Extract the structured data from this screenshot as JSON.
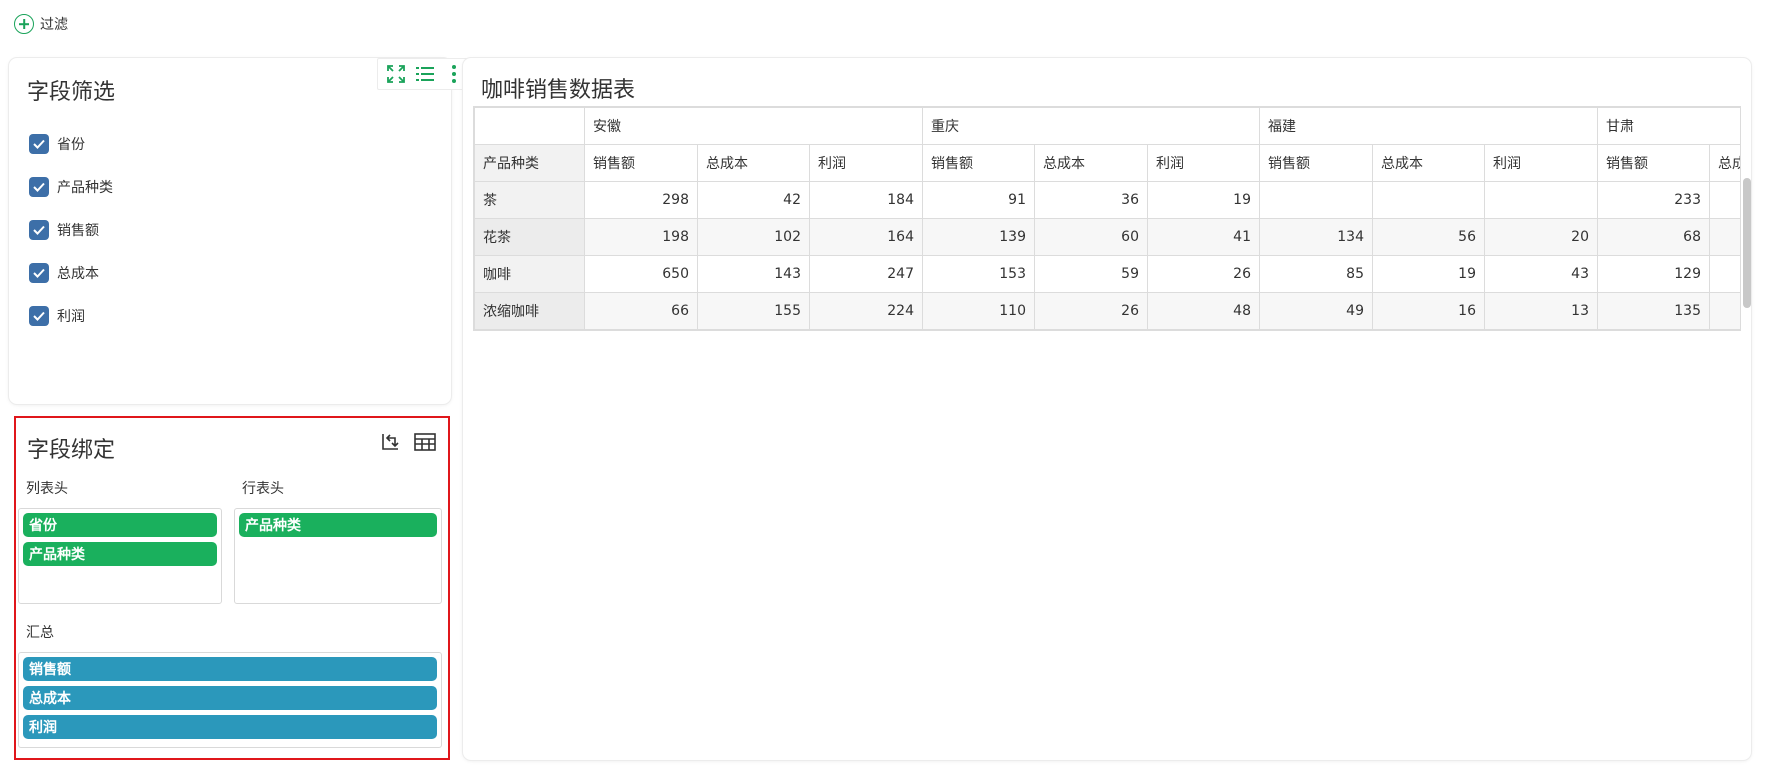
{
  "filter_bar": {
    "label": "过滤"
  },
  "field_filter": {
    "title": "字段筛选",
    "items": [
      {
        "label": "省份",
        "checked": true
      },
      {
        "label": "产品种类",
        "checked": true
      },
      {
        "label": "销售额",
        "checked": true
      },
      {
        "label": "总成本",
        "checked": true
      },
      {
        "label": "利润",
        "checked": true
      }
    ]
  },
  "field_binding": {
    "title": "字段绑定",
    "column_header_label": "列表头",
    "row_header_label": "行表头",
    "summary_label": "汇总",
    "column_fields": [
      "省份",
      "产品种类"
    ],
    "row_fields": [
      "产品种类"
    ],
    "summary_fields": [
      "销售额",
      "总成本",
      "利润"
    ]
  },
  "sales_table": {
    "title": "咖啡销售数据表",
    "row_header_title": "产品种类",
    "provinces": [
      "安徽",
      "重庆",
      "福建",
      "甘肃"
    ],
    "measures": [
      "销售额",
      "总成本",
      "利润"
    ],
    "last_province_visible_measures": [
      "销售额",
      "总成"
    ],
    "rows": [
      {
        "name": "茶",
        "values": [
          "298",
          "42",
          "184",
          "91",
          "36",
          "19",
          "",
          "",
          "",
          "233",
          ""
        ]
      },
      {
        "name": "花茶",
        "values": [
          "198",
          "102",
          "164",
          "139",
          "60",
          "41",
          "134",
          "56",
          "20",
          "68",
          ""
        ]
      },
      {
        "name": "咖啡",
        "values": [
          "650",
          "143",
          "247",
          "153",
          "59",
          "26",
          "85",
          "19",
          "43",
          "129",
          ""
        ]
      },
      {
        "name": "浓缩咖啡",
        "values": [
          "66",
          "155",
          "224",
          "110",
          "26",
          "48",
          "49",
          "16",
          "13",
          "135",
          ""
        ]
      }
    ]
  },
  "colors": {
    "accent_green": "#1ab05d",
    "accent_blue": "#2b98bb",
    "checkbox": "#3d6fa8",
    "highlight_border": "#e0161b"
  }
}
